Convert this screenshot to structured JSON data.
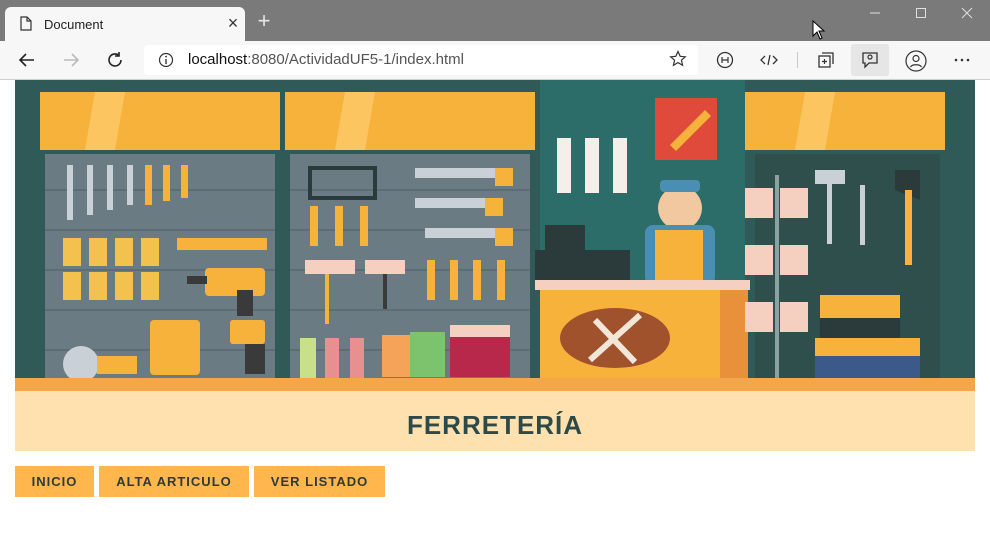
{
  "browser": {
    "tab_title": "Document",
    "tab_close": "×",
    "new_tab": "+",
    "url_host": "localhost",
    "url_rest": ":8080/ActividadUF5-1/index.html"
  },
  "page": {
    "heading": "FERRETERÍA",
    "nav": [
      "INICIO",
      "ALTA ARTICULO",
      "VER LISTADO"
    ]
  },
  "colors": {
    "accent": "#ffb74d",
    "heading_bg": "#ffe1b0",
    "heading_text": "#2d4a48",
    "banner_bg": "#2f5a57"
  }
}
